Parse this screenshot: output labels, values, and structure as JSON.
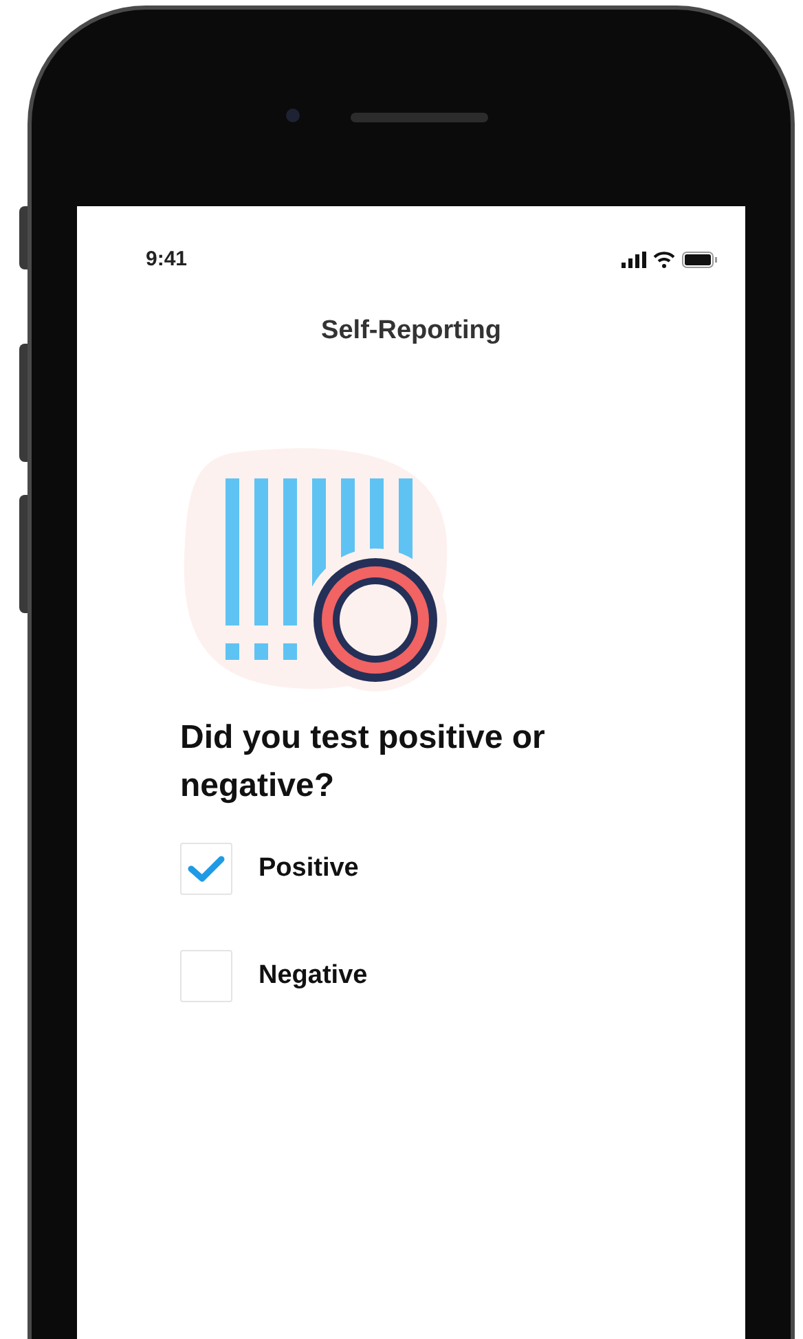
{
  "status_bar": {
    "time": "9:41"
  },
  "header": {
    "title": "Self-Reporting"
  },
  "question": "Did you test positive or negative?",
  "options": [
    {
      "label": "Positive",
      "checked": true
    },
    {
      "label": "Negative",
      "checked": false
    }
  ]
}
